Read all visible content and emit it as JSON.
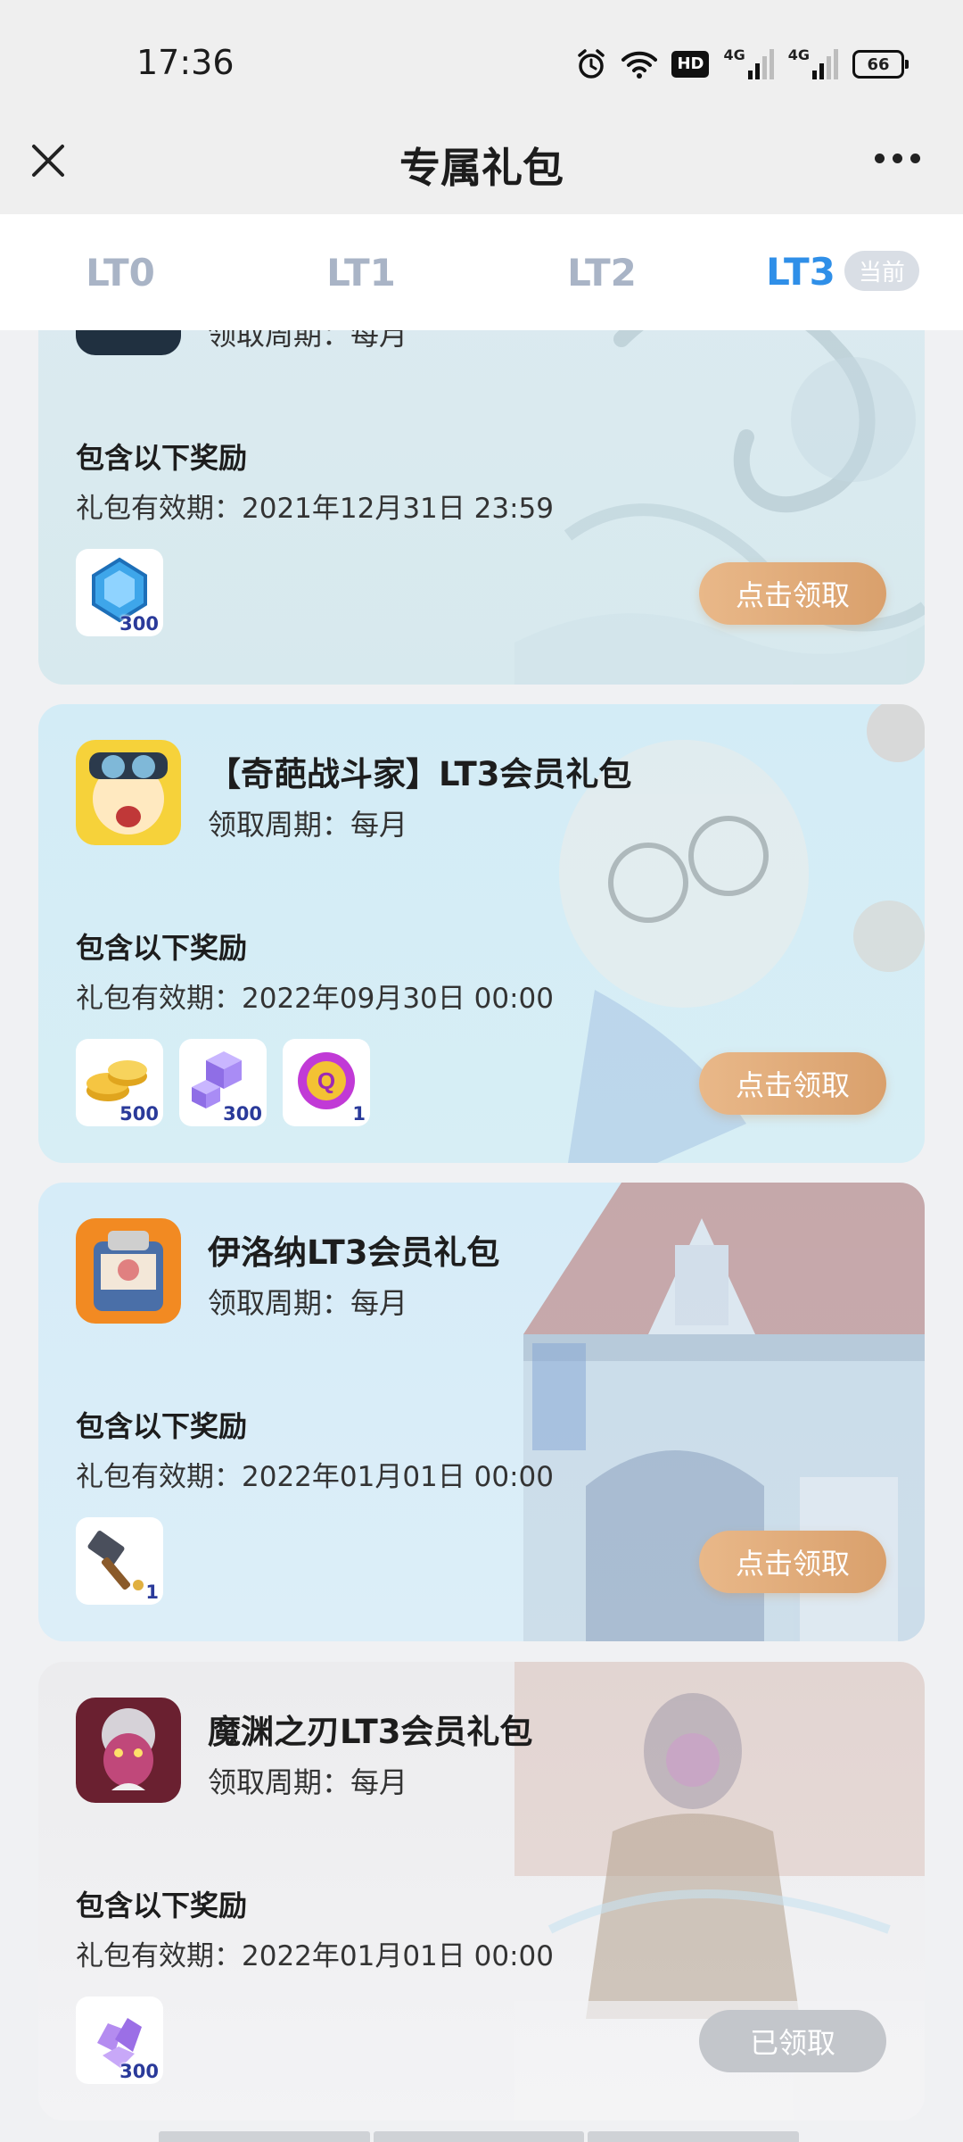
{
  "status_bar": {
    "time": "17:36",
    "icons": [
      "alarm-icon",
      "wifi-icon",
      "hd-icon",
      "signal-4g-icon",
      "signal-4g-icon",
      "battery-icon"
    ],
    "hd_label": "HD",
    "network_label": "4G",
    "battery_level": "66"
  },
  "header": {
    "title": "专属礼包",
    "close_icon": "close-icon",
    "more_icon": "more-icon"
  },
  "tabs": [
    {
      "label": "LT0",
      "active": false
    },
    {
      "label": "LT1",
      "active": false
    },
    {
      "label": "LT2",
      "active": false
    },
    {
      "label": "LT3",
      "active": true,
      "badge": "当前"
    }
  ],
  "colors": {
    "accent": "#2f8fe8",
    "claim_button": "#dfaa78",
    "claimed_button": "#c3c6cb",
    "tab_inactive": "#a9b4c6"
  },
  "gifts": [
    {
      "name": "",
      "cycle": "领取周期：每月",
      "rewards_title": "包含以下奖励",
      "validity": "礼包有效期：2021年12月31日 23:59",
      "rewards": [
        {
          "icon": "blue-gem-icon",
          "qty": "300"
        }
      ],
      "button": "点击领取",
      "claimed": false
    },
    {
      "name": "【奇葩战斗家】LT3会员礼包",
      "cycle": "领取周期：每月",
      "rewards_title": "包含以下奖励",
      "validity": "礼包有效期：2022年09月30日 00:00",
      "rewards": [
        {
          "icon": "gold-coins-icon",
          "qty": "500"
        },
        {
          "icon": "purple-cubes-icon",
          "qty": "300"
        },
        {
          "icon": "q-coin-icon",
          "qty": "1"
        }
      ],
      "button": "点击领取",
      "claimed": false
    },
    {
      "name": "伊洛纳LT3会员礼包",
      "cycle": "领取周期：每月",
      "rewards_title": "包含以下奖励",
      "validity": "礼包有效期：2022年01月01日 00:00",
      "rewards": [
        {
          "icon": "hammer-icon",
          "qty": "1"
        }
      ],
      "button": "点击领取",
      "claimed": false
    },
    {
      "name": "魔渊之刃LT3会员礼包",
      "cycle": "领取周期：每月",
      "rewards_title": "包含以下奖励",
      "validity": "礼包有效期：2022年01月01日 00:00",
      "rewards": [
        {
          "icon": "purple-crystal-icon",
          "qty": "300"
        }
      ],
      "button": "已领取",
      "claimed": true
    }
  ]
}
